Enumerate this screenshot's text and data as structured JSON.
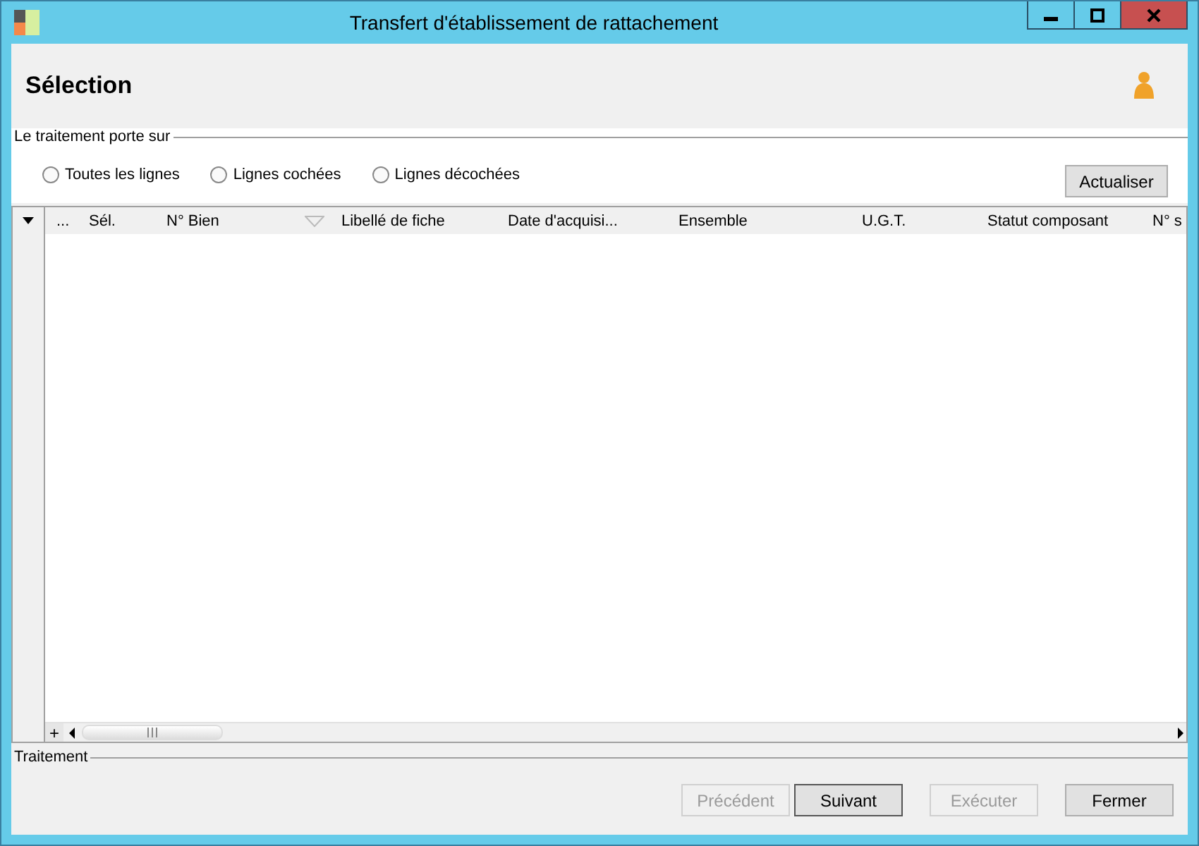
{
  "window": {
    "title": "Transfert d'établissement de rattachement"
  },
  "header": {
    "title": "Sélection"
  },
  "scope": {
    "legend": "Le traitement porte sur",
    "options": [
      {
        "label": "Toutes les lignes",
        "selected": false
      },
      {
        "label": "Lignes cochées",
        "selected": false
      },
      {
        "label": "Lignes décochées",
        "selected": false
      }
    ],
    "refresh_button": "Actualiser"
  },
  "table": {
    "columns": [
      {
        "label": "...",
        "filter": false
      },
      {
        "label": "Sél.",
        "filter": false
      },
      {
        "label": "N° Bien",
        "filter": true
      },
      {
        "label": "Libellé de fiche",
        "filter": false
      },
      {
        "label": "Date d'acquisi...",
        "filter": false
      },
      {
        "label": "Ensemble",
        "filter": false
      },
      {
        "label": "U.G.T.",
        "filter": false
      },
      {
        "label": "Statut composant",
        "filter": false
      },
      {
        "label": "N° s",
        "filter": false
      }
    ],
    "add_button": "+"
  },
  "footer": {
    "legend": "Traitement",
    "buttons": [
      {
        "label": "Précédent",
        "disabled": true,
        "default": false
      },
      {
        "label": "Suivant",
        "disabled": false,
        "default": true
      },
      {
        "label": "Exécuter",
        "disabled": true,
        "default": false
      },
      {
        "label": "Fermer",
        "disabled": false,
        "default": false
      }
    ]
  }
}
